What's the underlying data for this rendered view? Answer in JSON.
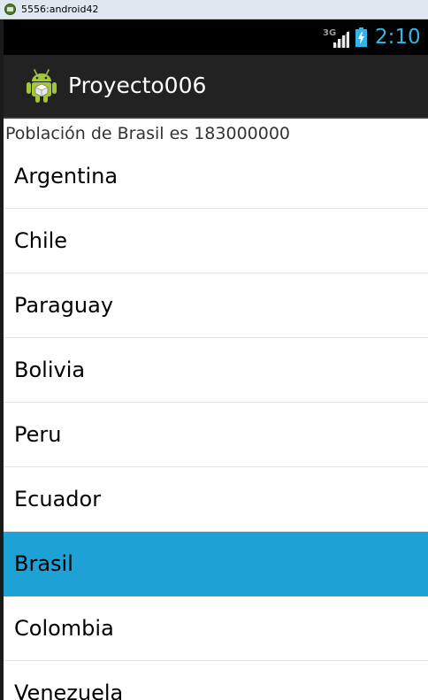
{
  "window": {
    "title": "5556:android42"
  },
  "status_bar": {
    "network": "3G",
    "time": "2:10",
    "accent_color": "#33b5e5"
  },
  "action_bar": {
    "app_icon": "android-robot-icon",
    "title": "Proyecto006"
  },
  "info_text": "Población de Brasil es 183000000",
  "country_list": {
    "selected_color": "#1ea2d6",
    "items": [
      {
        "label": "Argentina",
        "selected": false
      },
      {
        "label": "Chile",
        "selected": false
      },
      {
        "label": "Paraguay",
        "selected": false
      },
      {
        "label": "Bolivia",
        "selected": false
      },
      {
        "label": "Peru",
        "selected": false
      },
      {
        "label": "Ecuador",
        "selected": false
      },
      {
        "label": "Brasil",
        "selected": true
      },
      {
        "label": "Colombia",
        "selected": false
      },
      {
        "label": "Venezuela",
        "selected": false
      }
    ]
  }
}
